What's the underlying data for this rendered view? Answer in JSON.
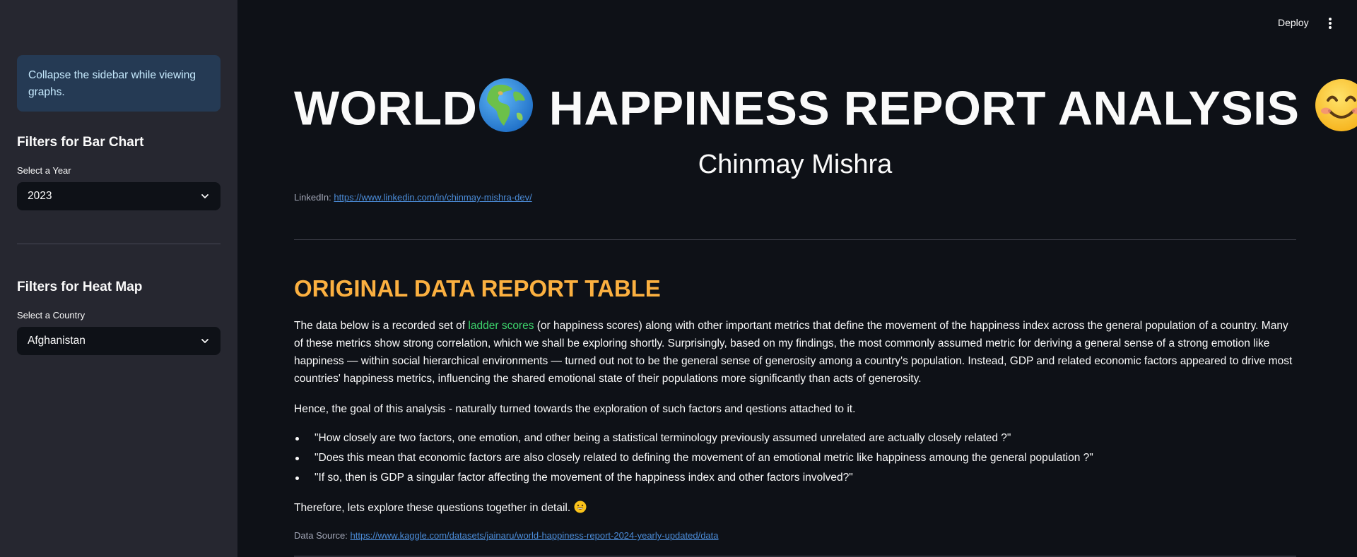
{
  "sidebar": {
    "info_text": "Collapse the sidebar while viewing graphs.",
    "bar_chart_heading": "Filters for Bar Chart",
    "year_label": "Select a Year",
    "year_value": "2023",
    "heat_map_heading": "Filters for Heat Map",
    "country_label": "Select a Country",
    "country_value": "Afghanistan"
  },
  "topbar": {
    "deploy_label": "Deploy"
  },
  "main": {
    "title_left": "WORLD",
    "title_right": "HAPPINESS REPORT ANALYSIS",
    "author": "Chinmay Mishra",
    "linkedin_label": "LinkedIn:",
    "linkedin_url": "https://www.linkedin.com/in/chinmay-mishra-dev/",
    "section_title": "ORIGINAL DATA REPORT TABLE",
    "para1_before": "The data below is a recorded set of ",
    "para1_highlight": "ladder scores",
    "para1_after": " (or happiness scores) along with other important metrics that define the movement of the happiness index across the general population of a country. Many of these metrics show strong correlation, which we shall be exploring shortly. Surprisingly, based on my findings, the most commonly assumed metric for deriving a general sense of a strong emotion like happiness — within social hierarchical environments — turned out not to be the general sense of generosity among a country's population. Instead, GDP and related economic factors appeared to drive most countries' happiness metrics, influencing the shared emotional state of their populations more significantly than acts of generosity.",
    "para2": "Hence, the goal of this analysis - naturally turned towards the exploration of such factors and qestions attached to it.",
    "questions": [
      "\"How closely are two factors, one emotion, and other being a statistical terminology previously assumed unrelated are actually closely related ?\"",
      "\"Does this mean that economic factors are also closely related to defining the movement of an emotional metric like happiness amoung the general population ?\"",
      "\"If so, then is GDP a singular factor affecting the movement of the happiness index and other factors involved?\""
    ],
    "para3": "Therefore, lets explore these questions together in detail.",
    "source_label": "Data Source:",
    "source_url": "https://www.kaggle.com/datasets/jainaru/world-happiness-report-2024-yearly-updated/data"
  },
  "icons": {
    "globe": "globe-emoji",
    "smile": "smiling-face-emoji",
    "grin": "grinning-face-emoji",
    "chevron": "chevron-down-icon",
    "menu": "vertical-ellipsis-icon"
  },
  "colors": {
    "background": "#0e1117",
    "sidebar": "#262730",
    "accent_orange": "#fbb040",
    "highlight_green": "#3dd56d",
    "link_blue": "#4b8cd8",
    "info_bg": "#253a54"
  }
}
